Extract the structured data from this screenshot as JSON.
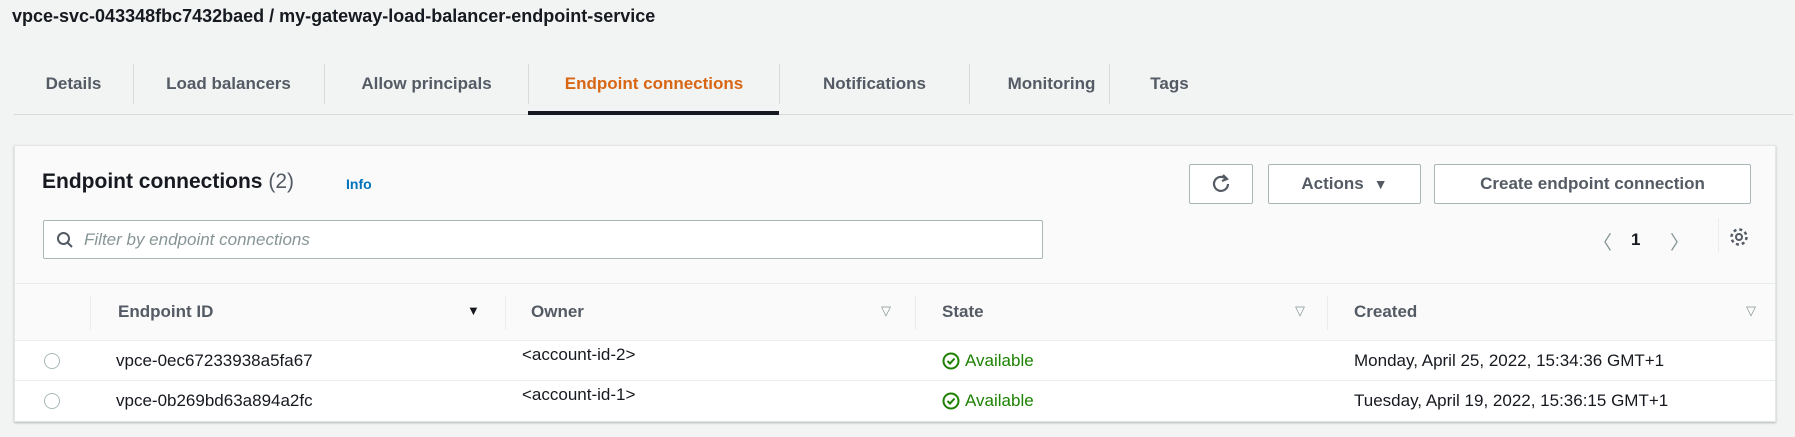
{
  "header": {
    "title": "vpce-svc-043348fbc7432baed / my-gateway-load-balancer-endpoint-service"
  },
  "tabs": [
    {
      "label": "Details"
    },
    {
      "label": "Load balancers"
    },
    {
      "label": "Allow principals"
    },
    {
      "label": "Endpoint connections",
      "active": true
    },
    {
      "label": "Notifications"
    },
    {
      "label": "Monitoring"
    },
    {
      "label": "Tags"
    }
  ],
  "card": {
    "title": "Endpoint connections",
    "count": "(2)",
    "info": "Info",
    "actions_label": "Actions",
    "create_label": "Create endpoint connection",
    "filter_placeholder": "Filter by endpoint connections",
    "page": "1"
  },
  "table": {
    "columns": [
      "Endpoint ID",
      "Owner",
      "State",
      "Created"
    ],
    "rows": [
      {
        "id": "vpce-0ec67233938a5fa67",
        "owner": "<account-id-2>",
        "state": "Available",
        "created": "Monday, April 25, 2022, 15:34:36 GMT+1"
      },
      {
        "id": "vpce-0b269bd63a894a2fc",
        "owner": "<account-id-1>",
        "state": "Available",
        "created": "Tuesday, April 19, 2022, 15:36:15 GMT+1"
      }
    ]
  },
  "colors": {
    "accent": "#d86613",
    "link": "#0073bb",
    "success": "#1d8102"
  }
}
